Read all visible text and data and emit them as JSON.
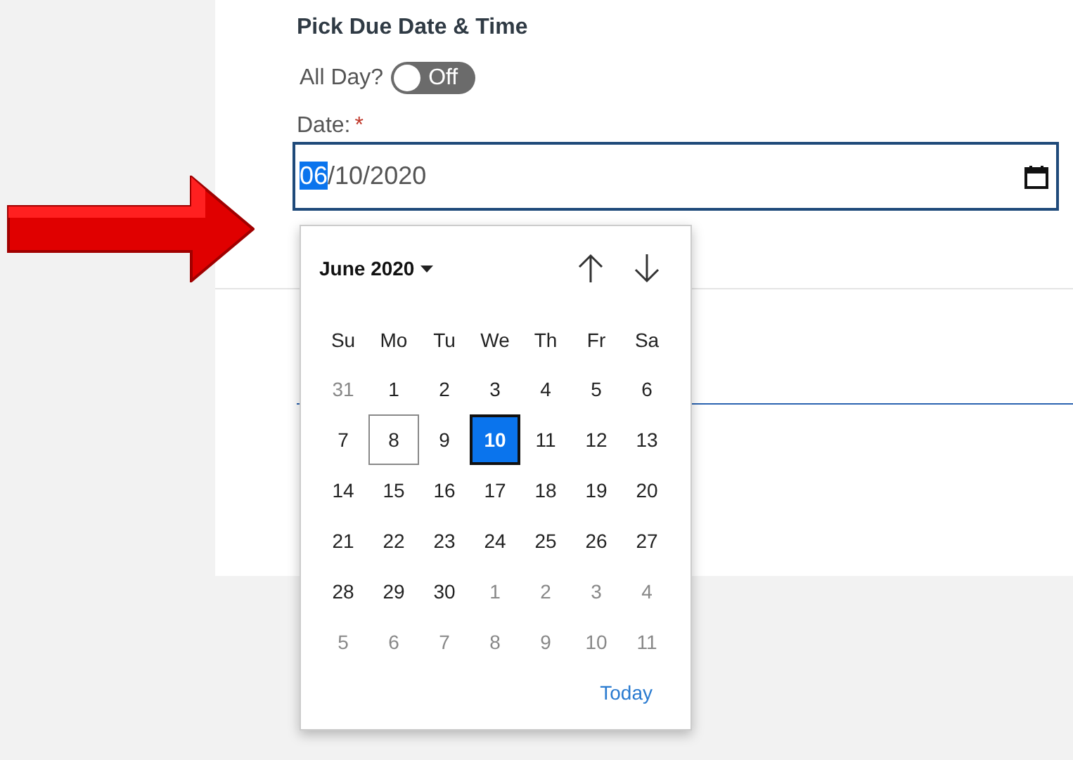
{
  "section_title": "Pick Due Date & Time",
  "all_day": {
    "label": "All Day?",
    "on": false,
    "state_text": "Off"
  },
  "date_field": {
    "label": "Date:",
    "required_mark": "*",
    "segments": [
      {
        "text": "06",
        "selected": true
      },
      {
        "text": "/10/2020",
        "selected": false
      }
    ]
  },
  "calendar": {
    "month_label": "June 2020",
    "weekdays": [
      "Su",
      "Mo",
      "Tu",
      "We",
      "Th",
      "Fr",
      "Sa"
    ],
    "weeks": [
      [
        {
          "day": "31",
          "other_month": true,
          "today": false,
          "selected": false
        },
        {
          "day": "1",
          "other_month": false,
          "today": false,
          "selected": false
        },
        {
          "day": "2",
          "other_month": false,
          "today": false,
          "selected": false
        },
        {
          "day": "3",
          "other_month": false,
          "today": false,
          "selected": false
        },
        {
          "day": "4",
          "other_month": false,
          "today": false,
          "selected": false
        },
        {
          "day": "5",
          "other_month": false,
          "today": false,
          "selected": false
        },
        {
          "day": "6",
          "other_month": false,
          "today": false,
          "selected": false
        }
      ],
      [
        {
          "day": "7",
          "other_month": false,
          "today": false,
          "selected": false
        },
        {
          "day": "8",
          "other_month": false,
          "today": true,
          "selected": false
        },
        {
          "day": "9",
          "other_month": false,
          "today": false,
          "selected": false
        },
        {
          "day": "10",
          "other_month": false,
          "today": false,
          "selected": true
        },
        {
          "day": "11",
          "other_month": false,
          "today": false,
          "selected": false
        },
        {
          "day": "12",
          "other_month": false,
          "today": false,
          "selected": false
        },
        {
          "day": "13",
          "other_month": false,
          "today": false,
          "selected": false
        }
      ],
      [
        {
          "day": "14",
          "other_month": false,
          "today": false,
          "selected": false
        },
        {
          "day": "15",
          "other_month": false,
          "today": false,
          "selected": false
        },
        {
          "day": "16",
          "other_month": false,
          "today": false,
          "selected": false
        },
        {
          "day": "17",
          "other_month": false,
          "today": false,
          "selected": false
        },
        {
          "day": "18",
          "other_month": false,
          "today": false,
          "selected": false
        },
        {
          "day": "19",
          "other_month": false,
          "today": false,
          "selected": false
        },
        {
          "day": "20",
          "other_month": false,
          "today": false,
          "selected": false
        }
      ],
      [
        {
          "day": "21",
          "other_month": false,
          "today": false,
          "selected": false
        },
        {
          "day": "22",
          "other_month": false,
          "today": false,
          "selected": false
        },
        {
          "day": "23",
          "other_month": false,
          "today": false,
          "selected": false
        },
        {
          "day": "24",
          "other_month": false,
          "today": false,
          "selected": false
        },
        {
          "day": "25",
          "other_month": false,
          "today": false,
          "selected": false
        },
        {
          "day": "26",
          "other_month": false,
          "today": false,
          "selected": false
        },
        {
          "day": "27",
          "other_month": false,
          "today": false,
          "selected": false
        }
      ],
      [
        {
          "day": "28",
          "other_month": false,
          "today": false,
          "selected": false
        },
        {
          "day": "29",
          "other_month": false,
          "today": false,
          "selected": false
        },
        {
          "day": "30",
          "other_month": false,
          "today": false,
          "selected": false
        },
        {
          "day": "1",
          "other_month": true,
          "today": false,
          "selected": false
        },
        {
          "day": "2",
          "other_month": true,
          "today": false,
          "selected": false
        },
        {
          "day": "3",
          "other_month": true,
          "today": false,
          "selected": false
        },
        {
          "day": "4",
          "other_month": true,
          "today": false,
          "selected": false
        }
      ],
      [
        {
          "day": "5",
          "other_month": true,
          "today": false,
          "selected": false
        },
        {
          "day": "6",
          "other_month": true,
          "today": false,
          "selected": false
        },
        {
          "day": "7",
          "other_month": true,
          "today": false,
          "selected": false
        },
        {
          "day": "8",
          "other_month": true,
          "today": false,
          "selected": false
        },
        {
          "day": "9",
          "other_month": true,
          "today": false,
          "selected": false
        },
        {
          "day": "10",
          "other_month": true,
          "today": false,
          "selected": false
        },
        {
          "day": "11",
          "other_month": true,
          "today": false,
          "selected": false
        }
      ]
    ],
    "today_link": "Today"
  }
}
